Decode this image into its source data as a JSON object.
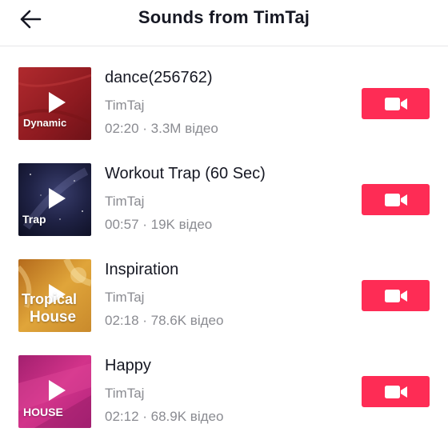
{
  "header": {
    "title": "Sounds from TimTaj",
    "back_icon": "arrow-left-icon"
  },
  "colors": {
    "accent": "#fe2c55",
    "text_primary": "#161823",
    "text_secondary": "#8a8b91"
  },
  "sounds": [
    {
      "title": "dance(256762)",
      "author": "TimTaj",
      "duration": "02:20",
      "videos": "3.3M відео",
      "meta": "02:20 · 3.3M відео",
      "cover_text": [
        "Dynamic"
      ],
      "cover_color": "#9b1c22"
    },
    {
      "title": "Workout Trap (60 Sec)",
      "author": "TimTaj",
      "duration": "00:57",
      "videos": "19K відео",
      "meta": "00:57 · 19K відео",
      "cover_text": [
        "Trap"
      ],
      "cover_color": "#1c1f3d"
    },
    {
      "title": "Inspiration",
      "author": "TimTaj",
      "duration": "02:18",
      "videos": "78.6K відео",
      "meta": "02:18 · 78.6K відео",
      "cover_text": [
        "Tropical",
        "House"
      ],
      "cover_color": "#d4952a"
    },
    {
      "title": "Happy",
      "author": "TimTaj",
      "duration": "02:12",
      "videos": "68.9K відео",
      "meta": "02:12 · 68.9K відео",
      "cover_text": [
        "HOUSE"
      ],
      "cover_color": "#c0287a"
    }
  ],
  "icons": {
    "play": "play-icon",
    "record": "video-camera-icon"
  }
}
